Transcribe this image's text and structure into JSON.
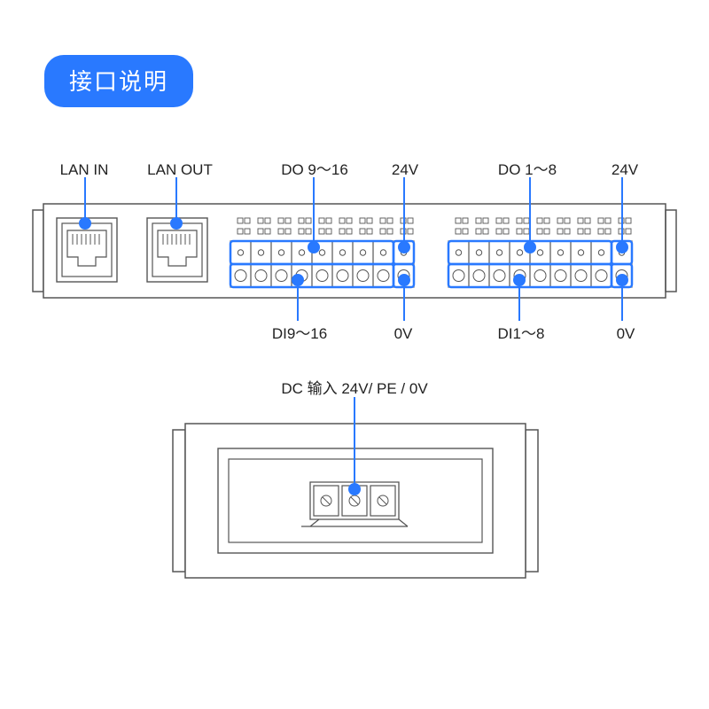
{
  "title_badge": "接口说明",
  "labels": {
    "lan_in": "LAN IN",
    "lan_out": "LAN OUT",
    "do_9_16": "DO 9～16",
    "di_9_16": "DI9～16",
    "do_1_8": "DO 1～8",
    "di_1_8": "DI1～8",
    "v24_a": "24V",
    "v24_b": "24V",
    "v0_a": "0V",
    "v0_b": "0V",
    "dc_input": "DC 输入  24V/ PE / 0V"
  }
}
